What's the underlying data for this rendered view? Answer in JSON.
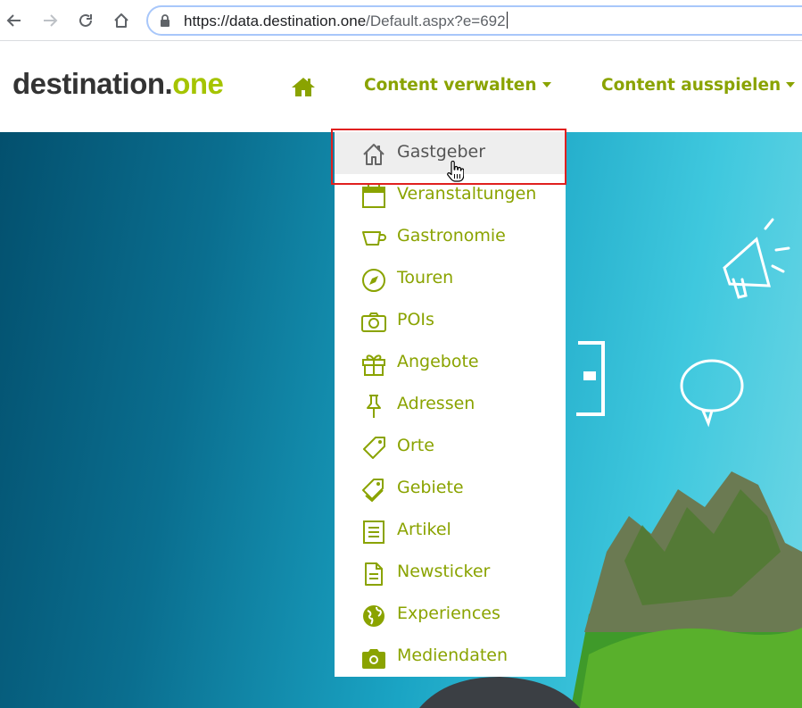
{
  "browser": {
    "url_host": "https://data.destination.one",
    "url_path": "/Default.aspx?e=692",
    "icons": [
      "back-arrow-icon",
      "forward-arrow-icon",
      "reload-icon",
      "home-icon",
      "lock-icon"
    ]
  },
  "header": {
    "logo_main": "destination.",
    "logo_accent": "one",
    "nav": [
      {
        "label": "Content verwalten"
      },
      {
        "label": "Content ausspielen"
      }
    ]
  },
  "dropdown": {
    "hovered_item": "Gastgeber",
    "items": [
      {
        "label": "Gastgeber",
        "icon": "house-icon"
      },
      {
        "label": "Veranstaltungen",
        "icon": "calendar-icon"
      },
      {
        "label": "Gastronomie",
        "icon": "cup-icon"
      },
      {
        "label": "Touren",
        "icon": "compass-icon"
      },
      {
        "label": "POIs",
        "icon": "camera-outline-icon"
      },
      {
        "label": "Angebote",
        "icon": "gift-icon"
      },
      {
        "label": "Adressen",
        "icon": "pushpin-icon"
      },
      {
        "label": "Orte",
        "icon": "tag-icon"
      },
      {
        "label": "Gebiete",
        "icon": "tags-icon"
      },
      {
        "label": "Artikel",
        "icon": "article-icon"
      },
      {
        "label": "Newsticker",
        "icon": "document-icon"
      },
      {
        "label": "Experiences",
        "icon": "globe-icon"
      },
      {
        "label": "Mediendaten",
        "icon": "camera-icon"
      }
    ]
  },
  "colors": {
    "brand_green": "#8aa300",
    "logo_green": "#a5c400",
    "highlight_red": "#e0201f"
  }
}
